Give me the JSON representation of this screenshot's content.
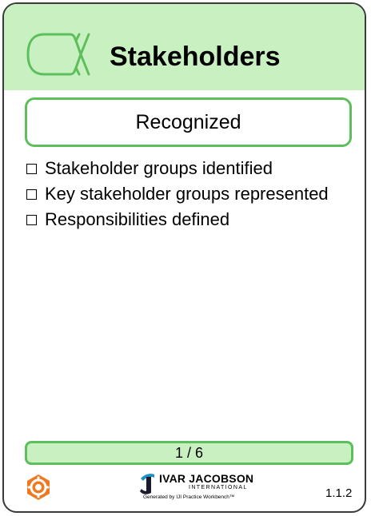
{
  "card": {
    "title": "Stakeholders",
    "state": "Recognized",
    "checklist": [
      "Stakeholder groups identified",
      "Key stakeholder groups represented",
      "Responsibilities defined"
    ],
    "progress": {
      "label": "1 / 6",
      "current": 1,
      "total": 6
    },
    "version": "1.1.2",
    "icons": {
      "alpha": "stakeholders-alpha-icon",
      "area": "gear-icon"
    },
    "colors": {
      "header": "#c8f0c0",
      "accent": "#5cbf5c",
      "gear": "#f07820"
    }
  },
  "logo": {
    "name": "IVAR JACOBSON",
    "subtitle": "INTERNATIONAL",
    "generated": "Generated by IJI Practice Workbench™"
  }
}
